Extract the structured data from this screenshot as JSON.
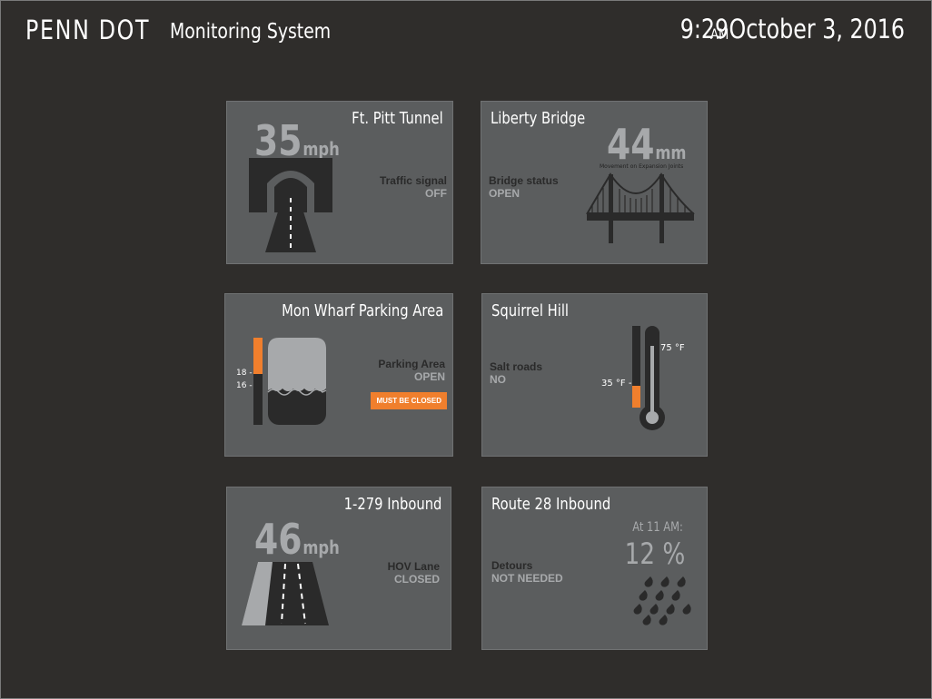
{
  "header": {
    "brand": "PENN DOT",
    "subtitle": "Monitoring System",
    "time": "9:29",
    "ampm": "AM",
    "date": "October 3, 2016"
  },
  "panels": {
    "ft_pitt_tunnel": {
      "title": "Ft. Pitt Tunnel",
      "speed": "35",
      "speed_unit": "mph",
      "status_label": "Traffic signal",
      "status_value": "OFF"
    },
    "liberty_bridge": {
      "title": "Liberty Bridge",
      "measure": "44",
      "measure_unit": "mm",
      "measure_caption": "Movement on Expansion Joints",
      "status_label": "Bridge status",
      "status_value": "OPEN"
    },
    "mon_wharf": {
      "title": "Mon Wharf Parking Area",
      "tick_high": "18 -",
      "tick_low": "16 -",
      "status_label": "Parking Area",
      "status_value": "OPEN",
      "alert": "MUST BE CLOSED"
    },
    "squirrel_hill": {
      "title": "Squirrel Hill",
      "status_label": "Salt roads",
      "status_value": "NO",
      "temp_low": "35 °F -",
      "temp_high": "75 °F"
    },
    "i279": {
      "title": "1-279 Inbound",
      "speed": "46",
      "speed_unit": "mph",
      "status_label": "HOV Lane",
      "status_value": "CLOSED"
    },
    "route28": {
      "title": "Route 28 Inbound",
      "forecast_time": "At 11 AM:",
      "forecast_value": "12 %",
      "status_label": "Detours",
      "status_value": "NOT NEEDED"
    }
  },
  "colors": {
    "background": "#2f2d2b",
    "panel": "#5b5d5e",
    "dark": "#2a2a2a",
    "muted": "#a7a9ab",
    "accent": "#f07f2d"
  }
}
